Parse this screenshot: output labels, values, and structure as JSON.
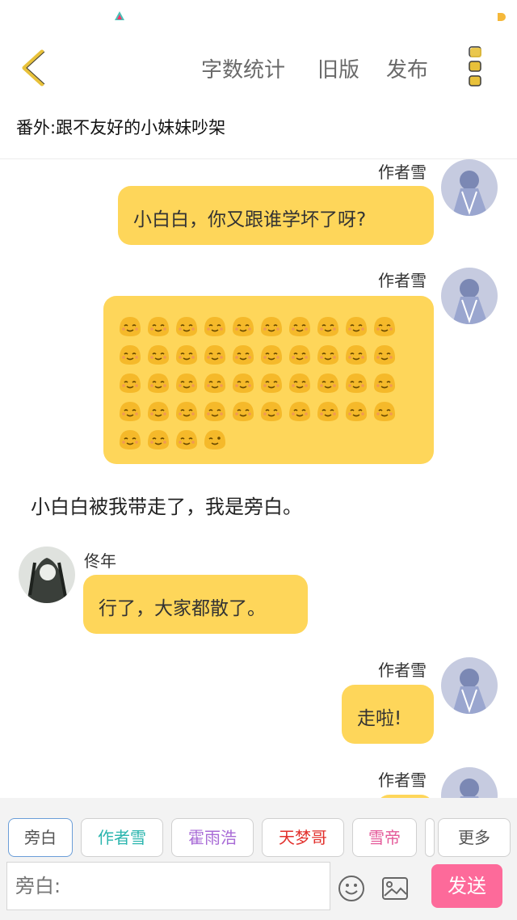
{
  "header": {
    "actions": [
      "字数统计",
      "旧版",
      "发布"
    ]
  },
  "chapter": {
    "title": "番外:跟不友好的小妹妹吵架"
  },
  "messages": {
    "m1": {
      "author": "作者雪",
      "text": "小白白，你又跟谁学坏了呀?"
    },
    "m2": {
      "author": "作者雪",
      "emoji_smile_count": 43,
      "emoji_wink_count": 1,
      "emoji_icon": "smiling-blob-emoji",
      "emoji_last_icon": "winking-blob-emoji"
    },
    "m3": {
      "text": "小白白被我带走了，我是旁白。"
    },
    "m4": {
      "author": "佟年",
      "text": "行了，大家都散了。"
    },
    "m5": {
      "author": "作者雪",
      "text": "走啦!"
    },
    "m6": {
      "author": "作者雪"
    }
  },
  "roles": [
    {
      "label": "旁白",
      "color": "#555555",
      "active": true
    },
    {
      "label": "作者雪",
      "color": "#2bb5ae"
    },
    {
      "label": "霍雨浩",
      "color": "#a86bd6"
    },
    {
      "label": "天梦哥",
      "color": "#e2302c"
    },
    {
      "label": "雪帝",
      "color": "#e45a9a"
    },
    {
      "label": "更多",
      "color": "#555555"
    }
  ],
  "composer": {
    "placeholder": "旁白:",
    "send_label": "发送"
  },
  "colors": {
    "bubble": "#fed65a",
    "accent": "#fd6a9a",
    "back_arrow": "#e8c13a"
  }
}
